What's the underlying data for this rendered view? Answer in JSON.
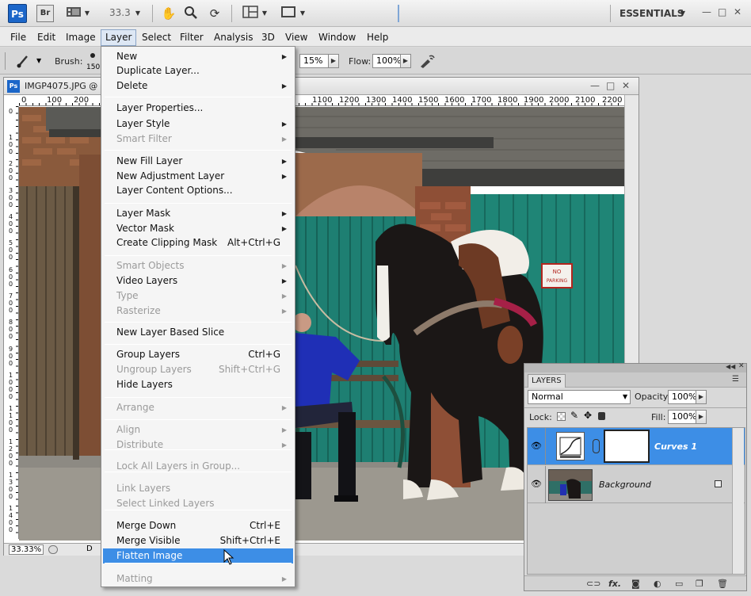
{
  "appbar": {
    "ps_logo": "Ps",
    "br_logo": "Br",
    "zoom": "33.3",
    "workspace": "ESSENTIALS",
    "icons": [
      "film-strip-icon",
      "hand-icon",
      "zoom-icon",
      "rotate-view-icon",
      "arrange-docs-icon",
      "screen-mode-icon"
    ]
  },
  "menubar": {
    "items": [
      "File",
      "Edit",
      "Image",
      "Layer",
      "Select",
      "Filter",
      "Analysis",
      "3D",
      "View",
      "Window",
      "Help"
    ],
    "active": "Layer"
  },
  "options": {
    "brush_label": "Brush:",
    "brush_size": "150",
    "opacity_value": "15%",
    "flow_label": "Flow:",
    "flow_value": "100%"
  },
  "document": {
    "title": "IMGP4075.JPG @ 3",
    "status_zoom": "33.33%",
    "status_doc": "D",
    "ruler_top": [
      "0",
      "100",
      "200",
      "1100",
      "1200",
      "1300",
      "1400",
      "1500",
      "1600",
      "1700",
      "1800",
      "1900",
      "2000",
      "2100",
      "2200"
    ],
    "ruler_left": [
      "0",
      "1 0 0",
      "2 0 0",
      "3 0 0",
      "4 0 0",
      "5 0 0",
      "6 0 0",
      "7 0 0",
      "8 0 0",
      "9 0 0",
      "1 0 0 0",
      "1 1 0 0",
      "1 2 0 0",
      "1 3 0 0",
      "1 4 0 0"
    ]
  },
  "photo": {
    "sign_line1": "NO",
    "sign_line2": "PARKING"
  },
  "layer_menu": {
    "items": [
      {
        "label": "New",
        "submenu": true
      },
      {
        "label": "Duplicate Layer..."
      },
      {
        "label": "Delete",
        "submenu": true
      },
      {
        "label": "Layer Properties..."
      },
      {
        "label": "Layer Style",
        "submenu": true
      },
      {
        "label": "Smart Filter",
        "submenu": true,
        "disabled": true
      },
      {
        "label": "New Fill Layer",
        "submenu": true
      },
      {
        "label": "New Adjustment Layer",
        "submenu": true
      },
      {
        "label": "Layer Content Options..."
      },
      {
        "label": "Layer Mask",
        "submenu": true
      },
      {
        "label": "Vector Mask",
        "submenu": true
      },
      {
        "label": "Create Clipping Mask",
        "shortcut": "Alt+Ctrl+G"
      },
      {
        "label": "Smart Objects",
        "submenu": true,
        "disabled": true
      },
      {
        "label": "Video Layers",
        "submenu": true
      },
      {
        "label": "Type",
        "submenu": true,
        "disabled": true
      },
      {
        "label": "Rasterize",
        "submenu": true,
        "disabled": true
      },
      {
        "label": "New Layer Based Slice"
      },
      {
        "label": "Group Layers",
        "shortcut": "Ctrl+G"
      },
      {
        "label": "Ungroup Layers",
        "shortcut": "Shift+Ctrl+G",
        "disabled": true
      },
      {
        "label": "Hide Layers"
      },
      {
        "label": "Arrange",
        "submenu": true,
        "disabled": true
      },
      {
        "label": "Align",
        "submenu": true,
        "disabled": true
      },
      {
        "label": "Distribute",
        "submenu": true,
        "disabled": true
      },
      {
        "label": "Lock All Layers in Group...",
        "disabled": true
      },
      {
        "label": "Link Layers",
        "disabled": true
      },
      {
        "label": "Select Linked Layers",
        "disabled": true
      },
      {
        "label": "Merge Down",
        "shortcut": "Ctrl+E"
      },
      {
        "label": "Merge Visible",
        "shortcut": "Shift+Ctrl+E"
      },
      {
        "label": "Flatten Image",
        "highlighted": true
      },
      {
        "label": "Matting",
        "submenu": true,
        "disabled": true
      }
    ]
  },
  "layers_panel": {
    "tab": "LAYERS",
    "blend_mode": "Normal",
    "opacity_label": "Opacity:",
    "opacity": "100%",
    "lock_label": "Lock:",
    "fill_label": "Fill:",
    "fill": "100%",
    "layers": [
      {
        "name": "Curves 1",
        "selected": true
      },
      {
        "name": "Background",
        "locked": true
      }
    ],
    "footer_fx": "fx."
  }
}
